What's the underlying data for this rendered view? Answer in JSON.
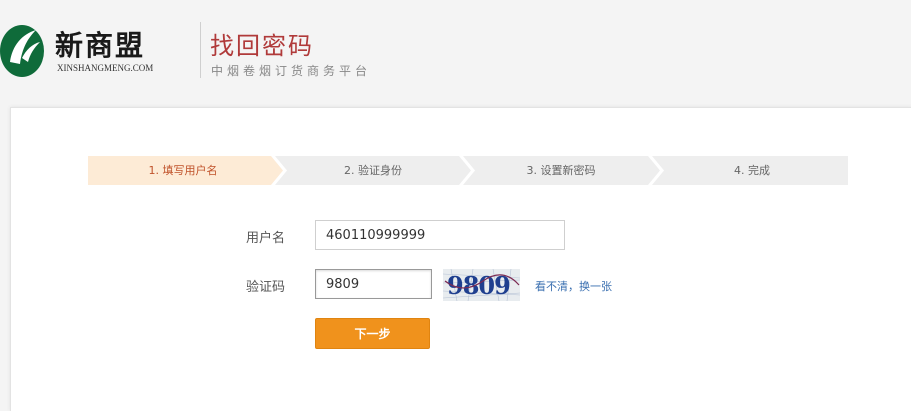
{
  "header": {
    "logo_text": "新商盟",
    "logo_sub": "XINSHANGMENG.COM",
    "title": "找回密码",
    "subtitle": "中烟卷烟订货商务平台"
  },
  "steps": [
    {
      "label": "1. 填写用户名",
      "active": true
    },
    {
      "label": "2. 验证身份",
      "active": false
    },
    {
      "label": "3. 设置新密码",
      "active": false
    },
    {
      "label": "4. 完成",
      "active": false
    }
  ],
  "form": {
    "username_label": "用户名",
    "username_value": "460110999999",
    "captcha_label": "验证码",
    "captcha_value": "9809",
    "captcha_image_text": "9809",
    "refresh_link": "看不清，换一张",
    "next_button": "下一步"
  },
  "colors": {
    "brand_green": "#0f6b3a",
    "title_red": "#b03a3a",
    "active_step_bg": "#fdebd6",
    "step_bg": "#eeeeee",
    "button_orange": "#f0921c",
    "link_blue": "#3a6fb0"
  }
}
